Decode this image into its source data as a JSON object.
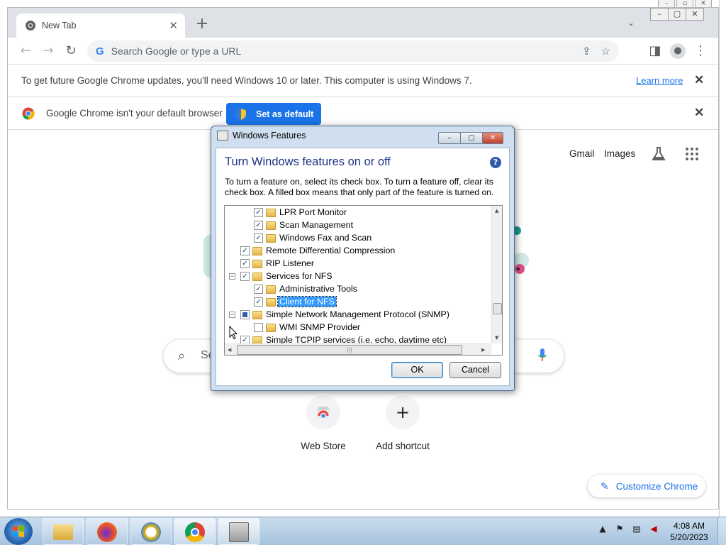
{
  "browser": {
    "tab_title": "New Tab",
    "omnibox_placeholder": "Search Google or type a URL",
    "update_message": "To get future Google Chrome updates, you'll need Windows 10 or later. This computer is using Windows 7.",
    "learn_more": "Learn more",
    "default_message": "Google Chrome isn't your default browser",
    "set_default": "Set as default"
  },
  "ntp": {
    "gmail": "Gmail",
    "images": "Images",
    "search_placeholder": "Se",
    "shortcuts": [
      {
        "label": "Web Store"
      },
      {
        "label": "Add shortcut",
        "icon": "+"
      }
    ],
    "customize": "Customize Chrome"
  },
  "dialog": {
    "title": "Windows Features",
    "heading": "Turn Windows features on or off",
    "description": "To turn a feature on, select its check box. To turn a feature off, clear its check box. A filled box means that only part of the feature is turned on.",
    "ok": "OK",
    "cancel": "Cancel",
    "features": [
      {
        "label": "LPR Port Monitor",
        "checked": true,
        "level": 1
      },
      {
        "label": "Scan Management",
        "checked": true,
        "level": 1
      },
      {
        "label": "Windows Fax and Scan",
        "checked": true,
        "level": 1
      },
      {
        "label": "Remote Differential Compression",
        "checked": true,
        "level": 0
      },
      {
        "label": "RIP Listener",
        "checked": true,
        "level": 0
      },
      {
        "label": "Services for NFS",
        "checked": true,
        "level": 0,
        "expanded": true
      },
      {
        "label": "Administrative Tools",
        "checked": true,
        "level": 1
      },
      {
        "label": "Client for NFS",
        "checked": true,
        "level": 1,
        "selected": true
      },
      {
        "label": "Simple Network Management Protocol (SNMP)",
        "checked": "partial",
        "level": 0,
        "expanded": true
      },
      {
        "label": "WMI SNMP Provider",
        "checked": false,
        "level": 1
      },
      {
        "label": "Simple TCPIP services (i.e. echo, daytime etc)",
        "checked": true,
        "level": 0
      }
    ]
  },
  "taskbar": {
    "time": "4:08 AM",
    "date": "5/20/2023",
    "apps": [
      "windows-explorer",
      "firefox",
      "vpn-client",
      "chrome",
      "windows-features"
    ]
  },
  "colors": {
    "accent": "#1a73e8",
    "dialog_heading": "#1e3287",
    "selection": "#3399ff"
  }
}
